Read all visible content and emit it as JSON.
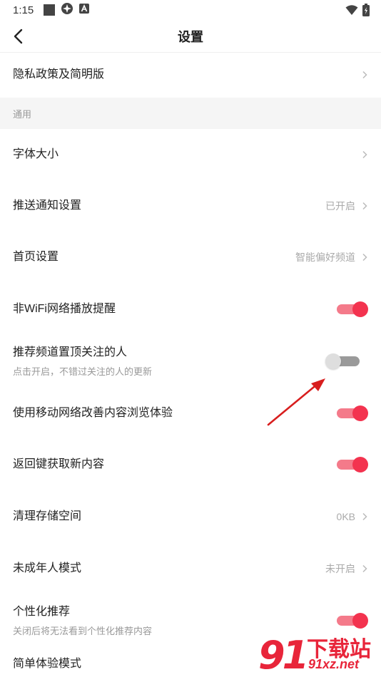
{
  "status_bar": {
    "time": "1:15"
  },
  "header": {
    "title": "设置"
  },
  "rows": {
    "privacy": {
      "label": "隐私政策及简明版"
    },
    "section_general": {
      "label": "通用"
    },
    "font_size": {
      "label": "字体大小"
    },
    "push": {
      "label": "推送通知设置",
      "value": "已开启"
    },
    "home": {
      "label": "首页设置",
      "value": "智能偏好频道"
    },
    "non_wifi": {
      "label": "非WiFi网络播放提醒",
      "toggle": true
    },
    "pin_followed": {
      "label": "推荐频道置顶关注的人",
      "sub": "点击开启，不错过关注的人的更新",
      "toggle": false
    },
    "mobile_network": {
      "label": "使用移动网络改善内容浏览体验",
      "toggle": true
    },
    "back_key": {
      "label": "返回键获取新内容",
      "toggle": true
    },
    "storage": {
      "label": "清理存储空间",
      "value": "0KB"
    },
    "minor_mode": {
      "label": "未成年人模式",
      "value": "未开启"
    },
    "personalized": {
      "label": "个性化推荐",
      "sub": "关闭后将无法看到个性化推荐内容",
      "toggle": true
    },
    "simple_mode": {
      "label": "简单体验模式"
    }
  },
  "watermark": {
    "digits": "91",
    "brand": "下载站",
    "url": "91xz.net"
  },
  "colors": {
    "accent": "#f3334f",
    "arrow": "#d81e1e"
  }
}
